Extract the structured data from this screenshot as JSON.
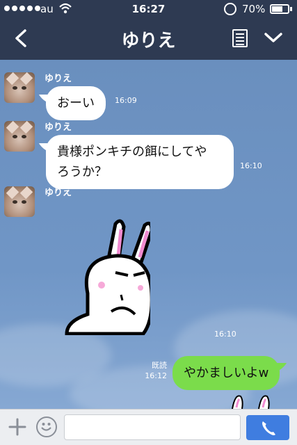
{
  "status_bar": {
    "carrier": "au",
    "time": "16:27",
    "battery_percent": "70%",
    "battery_level": 0.7,
    "signal_dots": 5
  },
  "header": {
    "title": "ゆりえ",
    "back_icon": "chevron-left-icon",
    "menu_icon": "note-icon",
    "dropdown_icon": "chevron-down-icon"
  },
  "messages": [
    {
      "sender": "ゆりえ",
      "text": "おーい",
      "time": "16:09"
    },
    {
      "sender": "ゆりえ",
      "text_line1": "貴様ポンキチの餌にしてや",
      "text_line2": "ろうか？",
      "time": "16:10"
    },
    {
      "sender": "ゆりえ",
      "sticker": "rabbit-sticker",
      "time": "16:10"
    },
    {
      "text": "やかましいよw",
      "read_label": "既読",
      "time": "16:12"
    }
  ],
  "input_bar": {
    "plus_icon": "plus-icon",
    "emoji_icon": "smiley-icon",
    "message_placeholder": "",
    "call_icon": "phone-icon"
  },
  "colors": {
    "header_bg": "#2e3a52",
    "chat_bg": "#7096c6",
    "my_bubble": "#7bdc4b",
    "their_bubble": "#ffffff",
    "call_button": "#3f7de0"
  }
}
